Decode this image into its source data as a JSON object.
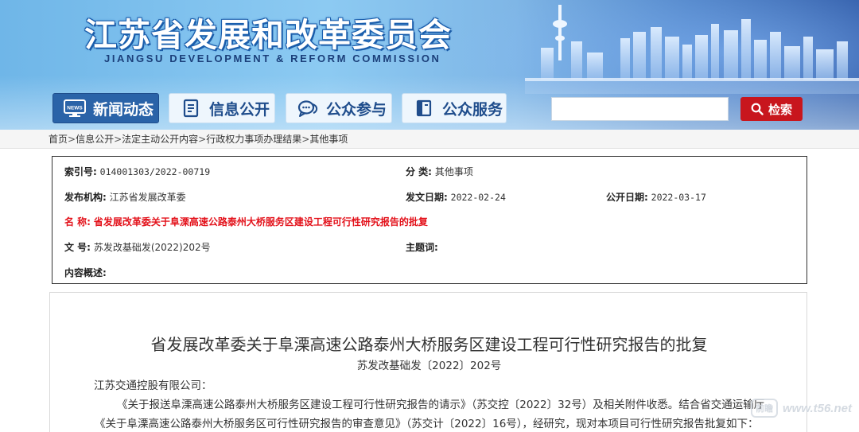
{
  "header": {
    "title": "江苏省发展和改革委员会",
    "subtitle": "JIANGSU DEVELOPMENT & REFORM COMMISSION"
  },
  "nav": {
    "items": [
      {
        "label": "新闻动态",
        "icon": "news-icon",
        "active": true
      },
      {
        "label": "信息公开",
        "icon": "document-icon",
        "active": false
      },
      {
        "label": "公众参与",
        "icon": "chat-icon",
        "active": false
      },
      {
        "label": "公众服务",
        "icon": "book-icon",
        "active": false
      }
    ],
    "news_badge": "NEWS"
  },
  "search": {
    "placeholder": "",
    "value": "",
    "button_label": "检索"
  },
  "breadcrumb": {
    "items": [
      "首页",
      "信息公开",
      "法定主动公开内容",
      "行政权力事项办理结果",
      "其他事项"
    ],
    "separator": ">"
  },
  "info": {
    "index_label": "索引号:",
    "index_value": "014001303/2022-00719",
    "category_label": "分 类:",
    "category_value": "其他事项",
    "publisher_label": "发布机构:",
    "publisher_value": "江苏省发展改革委",
    "issue_date_label": "发文日期:",
    "issue_date_value": "2022-02-24",
    "public_date_label": "公开日期:",
    "public_date_value": "2022-03-17",
    "name_label": "名 称:",
    "name_value": "省发展改革委关于阜溧高速公路泰州大桥服务区建设工程可行性研究报告的批复",
    "docno_label": "文 号:",
    "docno_value": "苏发改基础发(2022)202号",
    "keywords_label": "主题词:",
    "keywords_value": "",
    "summary_label": "内容概述:",
    "summary_value": ""
  },
  "article": {
    "title": "省发展改革委关于阜溧高速公路泰州大桥服务区建设工程可行性研究报告的批复",
    "doc_number": "苏发改基础发〔2022〕202号",
    "addressee": "江苏交通控股有限公司：",
    "paragraph_1": "《关于报送阜溧高速公路泰州大桥服务区建设工程可行性研究报告的请示》（苏交控〔2022〕32号）及相关附件收悉。结合省交通运输厅",
    "paragraph_2": "《关于阜溧高速公路泰州大桥服务区可行性研究报告的审查意见》（苏交计〔2022〕16号），经研究，现对本项目可行性研究报告批复如下："
  },
  "watermark": {
    "badge": "前瞻",
    "text": "www.t56.net"
  },
  "colors": {
    "nav_active": "#2a63a8",
    "search_button": "#c8161d",
    "title_red": "#e3121b"
  }
}
